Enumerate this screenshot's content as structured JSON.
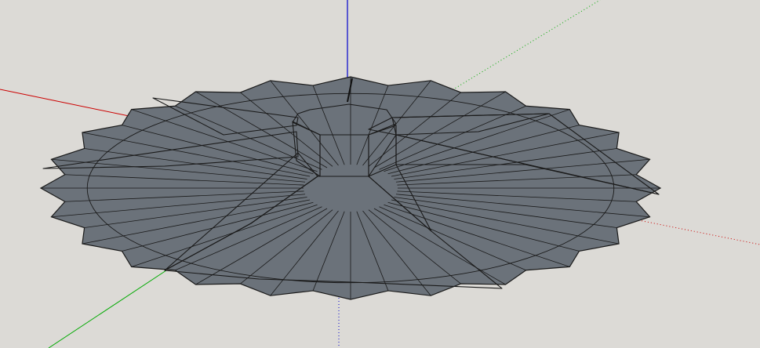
{
  "viewport": {
    "background_color": "#dcdad6"
  },
  "axes": {
    "red_axis_color": "#cc0000",
    "green_axis_color": "#00aa00",
    "blue_axis_color": "#0000cc"
  },
  "model": {
    "base_face_color": "#6b727a",
    "arm_light_face_color": "#c7d4dc",
    "arm_lit_face_color": "#ffffff",
    "arm_shadow_face_color": "#8f969c",
    "hub_top_color": "#a6a6a6",
    "hub_front_color": "#ffffff",
    "hub_side_color": "#8d9398",
    "edge_color": "#1a1a1a",
    "base_polygon_sides": 24,
    "hub_polygon_sides": 8,
    "arm_count": 5
  }
}
